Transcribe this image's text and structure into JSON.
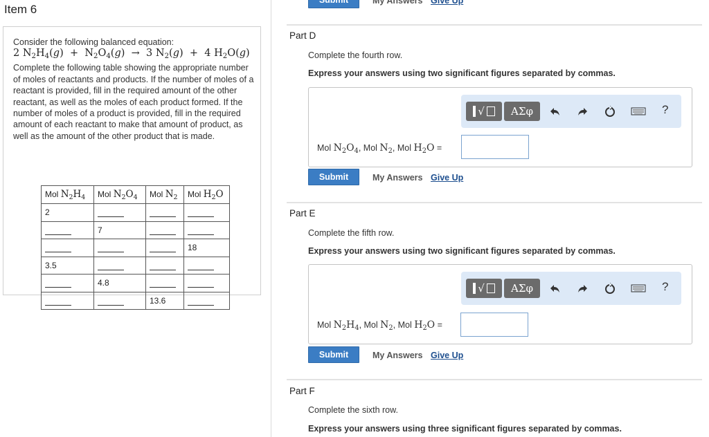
{
  "item": {
    "title": "Item 6"
  },
  "problem": {
    "intro": "Consider the following balanced equation:",
    "equation": {
      "r1_coef": "2",
      "r1": "N",
      "r1_sub1": "2",
      "r1_b": "H",
      "r1_sub2": "4",
      "r1_state": "g",
      "r2": "N",
      "r2_sub1": "2",
      "r2_b": "O",
      "r2_sub2": "4",
      "r2_state": "g",
      "arrow": "→",
      "p1_coef": "3",
      "p1": "N",
      "p1_sub1": "2",
      "p1_state": "g",
      "p2_coef": "4",
      "p2": "H",
      "p2_sub1": "2",
      "p2_b": "O",
      "p2_state": "g"
    },
    "body": "Complete the following table showing the appropriate number of moles of reactants and products. If the number of moles of a reactant is provided, fill in the required amount of the other reactant, as well as the moles of each product formed. If the number of moles of a product is provided, fill in the required amount of each reactant to make that amount of product, as well as the amount of the other product that is made.",
    "table": {
      "headers": [
        {
          "prefix": "Mol",
          "a": "N",
          "s1": "2",
          "b": "H",
          "s2": "4"
        },
        {
          "prefix": "Mol",
          "a": "N",
          "s1": "2",
          "b": "O",
          "s2": "4"
        },
        {
          "prefix": "Mol",
          "a": "N",
          "s1": "2",
          "b": "",
          "s2": ""
        },
        {
          "prefix": "Mol",
          "a": "H",
          "s1": "2",
          "b": "O",
          "s2": ""
        }
      ],
      "rows": [
        [
          "2",
          "",
          "",
          ""
        ],
        [
          "",
          "7",
          "",
          ""
        ],
        [
          "",
          "",
          "",
          "18"
        ],
        [
          "3.5",
          "",
          "",
          ""
        ],
        [
          "",
          "4.8",
          "",
          ""
        ],
        [
          "",
          "",
          "13.6",
          ""
        ]
      ]
    }
  },
  "top_fragment": {
    "submit": "Submit",
    "my_answers": "My Answers",
    "give_up": "Give Up"
  },
  "parts": [
    {
      "title": "Part D",
      "instruction": "Complete the fourth row.",
      "bold_instruction": "Express your answers using two significant figures separated by commas.",
      "answer_label": {
        "prefix": "Mol",
        "x1": "N",
        "x1s1": "2",
        "x1b": "O",
        "x1s2": "4",
        "sep1": ", Mol",
        "x2": "N",
        "x2s1": "2",
        "sep2": ", Mol",
        "x3": "H",
        "x3s1": "2",
        "x3b": "O",
        "eq": " ="
      },
      "input_value": "",
      "submit": "Submit",
      "my_answers": "My Answers",
      "give_up": "Give Up"
    },
    {
      "title": "Part E",
      "instruction": "Complete the fifth row.",
      "bold_instruction": "Express your answers using two significant figures separated by commas.",
      "answer_label": {
        "prefix": "Mol",
        "x1": "N",
        "x1s1": "2",
        "x1b": "H",
        "x1s2": "4",
        "sep1": ", Mol",
        "x2": "N",
        "x2s1": "2",
        "sep2": ", Mol",
        "x3": "H",
        "x3s1": "2",
        "x3b": "O",
        "eq": " ="
      },
      "input_value": "",
      "submit": "Submit",
      "my_answers": "My Answers",
      "give_up": "Give Up"
    },
    {
      "title": "Part F",
      "instruction": "Complete the sixth row.",
      "bold_instruction": "Express your answers using three significant figures separated by commas."
    }
  ],
  "toolbar": {
    "templates_icon": "templates-radical-icon",
    "greek_label": "ΑΣφ",
    "undo_icon": "undo-icon",
    "redo_icon": "redo-icon",
    "reset_icon": "reset-icon",
    "keyboard_icon": "keyboard-icon",
    "help_label": "?"
  },
  "colors": {
    "submit_bg": "#3b7dc4",
    "toolbar_bg": "#dde9f7",
    "give_up": "#1e4f8f"
  }
}
